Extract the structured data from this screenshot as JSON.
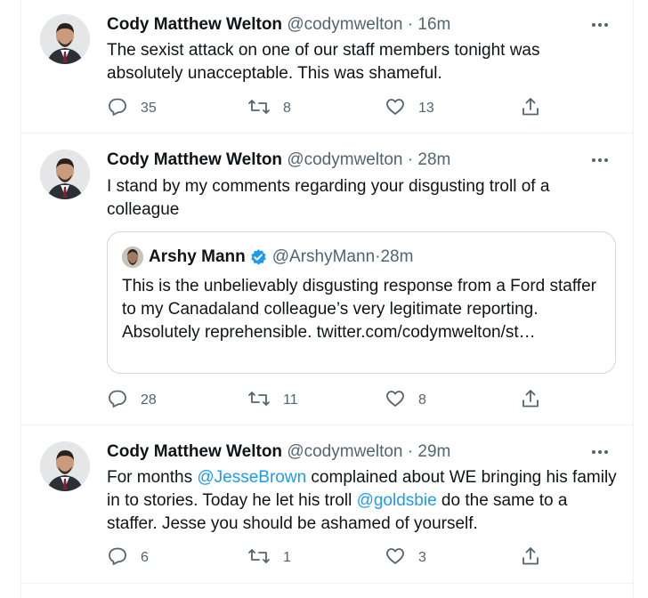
{
  "tweets": [
    {
      "name": "Cody Matthew Welton",
      "handle": "@codymwelton",
      "sep": " · ",
      "time": "16m",
      "text": "The sexist attack on one of our staff members tonight was absolutely unacceptable. This was shameful.",
      "replies": "35",
      "retweets": "8",
      "likes": "13"
    },
    {
      "name": "Cody Matthew Welton",
      "handle": "@codymwelton",
      "sep": " · ",
      "time": "28m",
      "text": "I stand by my comments regarding  your disgusting troll of a colleague",
      "quote": {
        "name": "Arshy Mann",
        "handle": "@ArshyMann",
        "sep": " · ",
        "time": "28m",
        "text": "This is the unbelievably disgusting response from a Ford staffer to my Canadaland colleague’s very legitimate reporting.    Absolutely reprehensible. twitter.com/codymwelton/st…"
      },
      "replies": "28",
      "retweets": "11",
      "likes": "8"
    },
    {
      "name": "Cody Matthew Welton",
      "handle": "@codymwelton",
      "sep": " · ",
      "time": "29m",
      "text_parts": {
        "a": "For months ",
        "mention1": "@JesseBrown",
        "b": " complained about WE bringing his family in to stories. Today he let his troll ",
        "mention2": "@goldsbie",
        "c": " do the same to a staffer. Jesse you should be ashamed of yourself."
      },
      "replies": "6",
      "retweets": "1",
      "likes": "3"
    }
  ],
  "icons": {
    "reply": "reply-icon",
    "retweet": "retweet-icon",
    "like": "heart-icon",
    "share": "share-icon",
    "more": "more-icon",
    "verified": "verified-badge-icon"
  },
  "colors": {
    "text": "#0f1419",
    "secondary": "#536471",
    "link": "#1d9bf0",
    "border": "#eff3f4"
  }
}
